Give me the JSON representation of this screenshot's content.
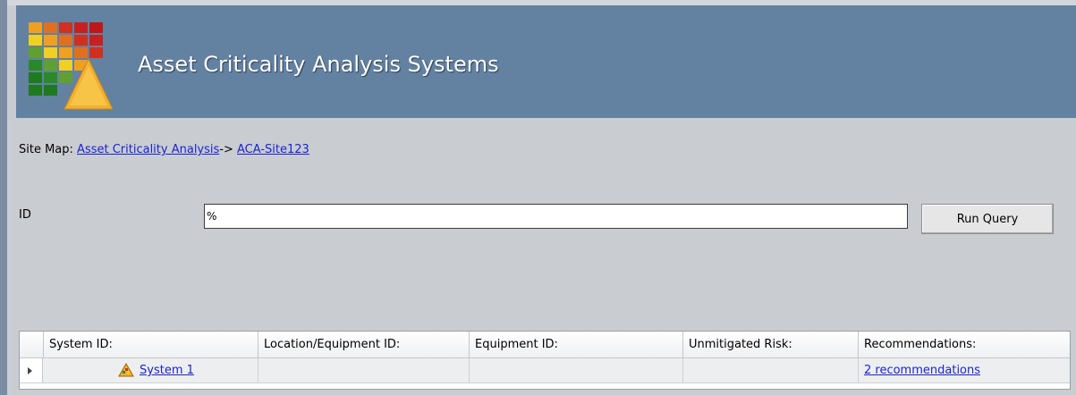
{
  "header": {
    "title": "Asset Criticality Analysis Systems",
    "logo_icon": "risk-matrix-logo-icon",
    "background_color": "#6381a1"
  },
  "site_map": {
    "label": "Site Map:",
    "links": [
      {
        "text": "Asset Criticality Analysis"
      },
      {
        "text": "ACA-Site123"
      }
    ],
    "separator": "->"
  },
  "query": {
    "id_label": "ID",
    "id_value": "%",
    "run_button_label": "Run Query"
  },
  "grid": {
    "columns": [
      "System ID:",
      "Location/Equipment ID:",
      "Equipment ID:",
      "Unmitigated Risk:",
      "Recommendations:"
    ],
    "rows": [
      {
        "icon": "risk-triangle-icon",
        "system_id": "System 1",
        "location_equipment_id": "",
        "equipment_id": "",
        "unmitigated_risk": "",
        "recommendations": "2 recommendations"
      }
    ]
  },
  "colors": {
    "link": "#1a23d6",
    "page_background": "#c9ccd0"
  }
}
